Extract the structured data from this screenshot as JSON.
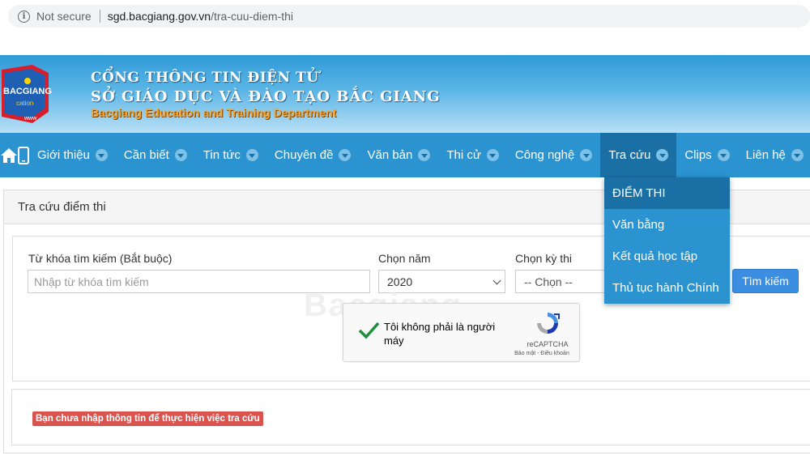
{
  "browser": {
    "security_label": "Not secure",
    "url_host": "sgd.bacgiang.gov.vn",
    "url_path": "/tra-cuu-diem-thi"
  },
  "header": {
    "logo_text": "BACGIANG",
    "logo_sub": "cation",
    "logo_www": "www",
    "line1": "CỔNG THÔNG TIN ĐIỆN TỬ",
    "line2": "SỞ GIÁO DỤC VÀ ĐÀO TẠO BẮC GIANG",
    "line3": "Bacgiang Education and Training Department"
  },
  "nav": {
    "items": [
      {
        "label": "Giới thiệu"
      },
      {
        "label": "Cần biết"
      },
      {
        "label": "Tin tức"
      },
      {
        "label": "Chuyên đề"
      },
      {
        "label": "Văn bản"
      },
      {
        "label": "Thi cử"
      },
      {
        "label": "Công nghệ"
      },
      {
        "label": "Tra cứu"
      },
      {
        "label": "Clips"
      },
      {
        "label": "Liên hệ"
      }
    ],
    "active_color": "#1a6fa5",
    "bar_color": "#2b93cf"
  },
  "dropdown": {
    "items": [
      {
        "label": "ĐIỂM THI"
      },
      {
        "label": "Văn bằng"
      },
      {
        "label": "Kết quả học tập"
      },
      {
        "label": "Thủ tục hành Chính"
      }
    ]
  },
  "panel": {
    "title": "Tra cứu điểm thi"
  },
  "form": {
    "keyword_label": "Từ khóa tìm kiếm (Bắt buộc)",
    "keyword_placeholder": "Nhập từ khóa tìm kiếm",
    "year_label": "Chọn năm",
    "year_value": "2020",
    "exam_label": "Chọn kỳ thi",
    "exam_value": "-- Chọn --",
    "search_label": "Tìm kiếm"
  },
  "captcha": {
    "text": "Tôi không phải là người máy",
    "brand": "reCAPTCHA",
    "terms": "Bảo mật - Điều khoản"
  },
  "watermark": "Bacgiang",
  "alert": {
    "message": "Bạn chưa nhập thông tin để thực hiện việc tra cứu",
    "color": "#d9534f"
  },
  "accent_color": "#3c8fe0"
}
